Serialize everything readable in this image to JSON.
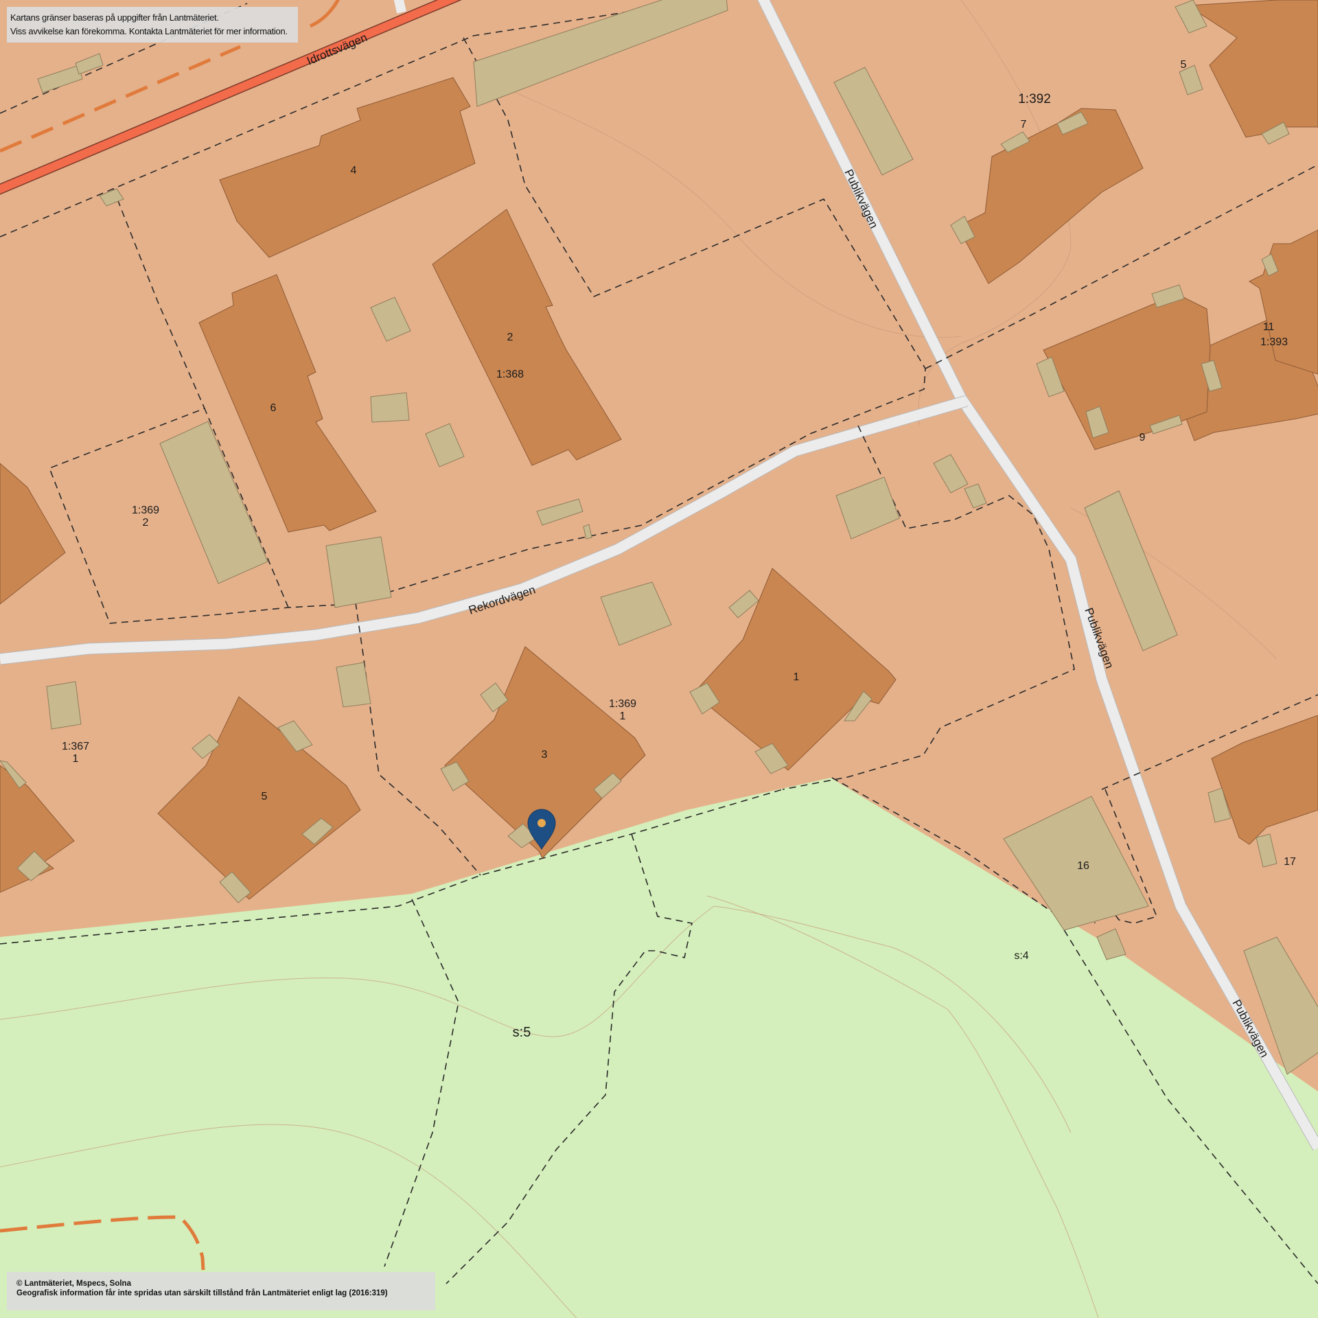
{
  "notice": {
    "line1": "Kartans gränser baseras på uppgifter från Lantmäteriet.",
    "line2": "Viss avvikelse kan förekomma. Kontakta Lantmäteriet för mer information."
  },
  "copyright": {
    "line1": "© Lantmäteriet, Mspecs, Solna",
    "line2": "Geografisk information får inte spridas utan särskilt tillstånd från Lantmäteriet enligt lag (2016:319)"
  },
  "roads": {
    "idrottsvagen": "Idrottsvägen",
    "rekordvagen": "Rekordvägen",
    "publikvagen": "Publikvägen"
  },
  "buildings": {
    "b4": "4",
    "b2": "2",
    "b6": "6",
    "b5_west": "5",
    "b3": "3",
    "b1": "1",
    "b16": "16",
    "b5_ne": "5",
    "b7": "7",
    "b9": "9",
    "b11": "11",
    "b17": "17"
  },
  "parcels": {
    "p368": "1:368",
    "p369_2": "1:369",
    "p369_2_sub": "2",
    "p369_1": "1:369",
    "p369_1_sub": "1",
    "p367_1": "1:367",
    "p367_1_sub": "1",
    "p392": "1:392",
    "p393": "1:393",
    "s5": "s:5",
    "s4": "s:4"
  },
  "colors": {
    "residential": "#e5b18b",
    "green_area": "#d4efbb",
    "building": "#c98651",
    "outbuilding": "#c9b98f",
    "local_road": "#ececec",
    "main_road": "#f26b4b",
    "path": "#e07b3c",
    "marker": "#1d4f85"
  },
  "marker": {
    "icon": "location-pin-icon"
  }
}
